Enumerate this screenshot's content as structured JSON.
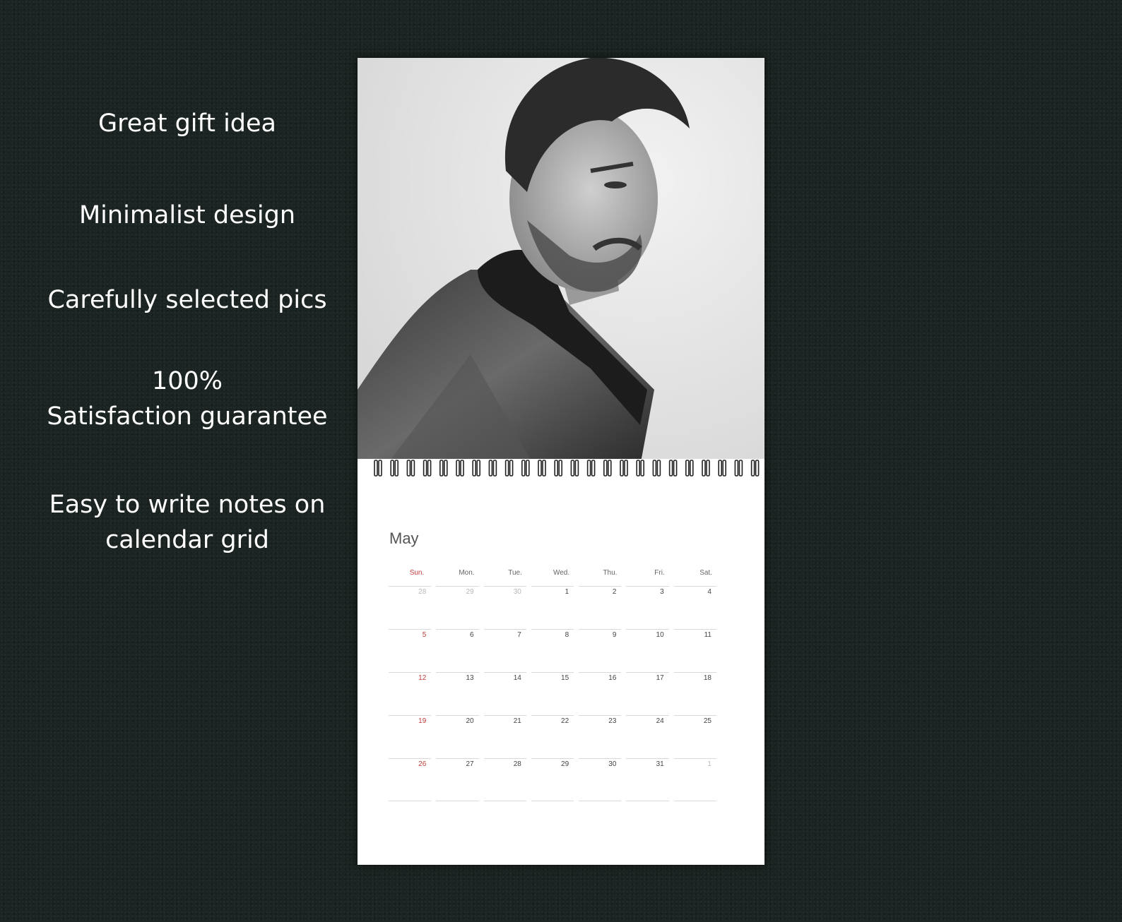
{
  "features": [
    {
      "text": "Great gift idea"
    },
    {
      "text": "Minimalist design"
    },
    {
      "text": "Carefully selected pics"
    },
    {
      "line1": "100%",
      "line2": "Satisfaction guarantee"
    },
    {
      "line1": "Easy to write notes on",
      "line2": "calendar grid"
    }
  ],
  "calendar": {
    "photo_icon": "portrait-photo",
    "month": "May",
    "weekdays": [
      "Sun.",
      "Mon.",
      "Tue.",
      "Wed.",
      "Thu.",
      "Fri.",
      "Sat."
    ],
    "weeks": [
      [
        "28",
        "29",
        "30",
        "1",
        "2",
        "3",
        "4"
      ],
      [
        "5",
        "6",
        "7",
        "8",
        "9",
        "10",
        "11"
      ],
      [
        "12",
        "13",
        "14",
        "15",
        "16",
        "17",
        "18"
      ],
      [
        "19",
        "20",
        "21",
        "22",
        "23",
        "24",
        "25"
      ],
      [
        "26",
        "27",
        "28",
        "29",
        "30",
        "31",
        "1"
      ]
    ],
    "outside_month_days": [
      [
        0,
        0
      ],
      [
        0,
        1
      ],
      [
        0,
        2
      ],
      [
        4,
        6
      ]
    ],
    "colors": {
      "sunday": "#c23b3b",
      "outside": "#b8b8b8",
      "background": "#1b2422"
    }
  }
}
